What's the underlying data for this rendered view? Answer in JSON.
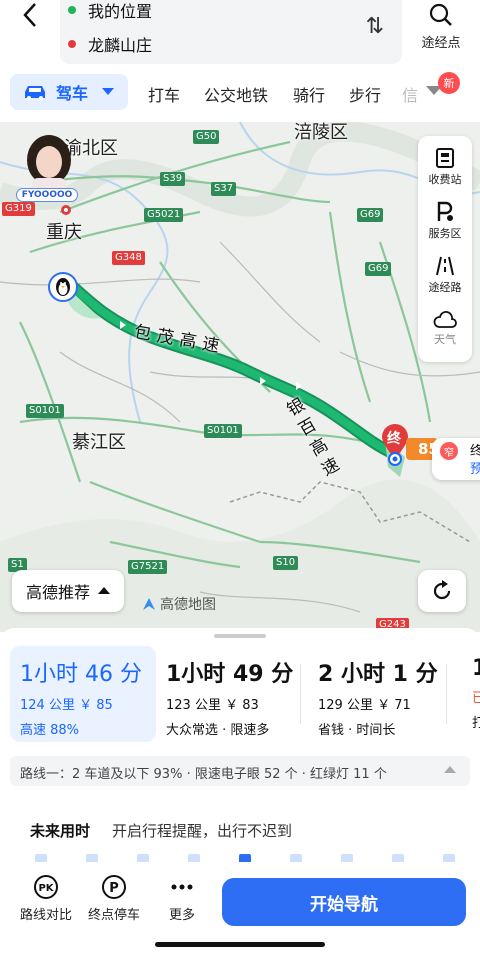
{
  "header": {
    "origin": "我的位置",
    "destination": "龙麟山庄",
    "waypoint_label": "途经点",
    "origin_color": "#1fb455",
    "destination_color": "#e23b3b"
  },
  "modes": {
    "drive_label": "驾车",
    "items": [
      "打车",
      "公交地铁",
      "骑行",
      "步行"
    ],
    "new_badge": "新"
  },
  "map": {
    "places": [
      "渝北区",
      "涪陵区",
      "重庆",
      "綦江区"
    ],
    "road_badges": [
      "G50",
      "S39",
      "S37",
      "G5021",
      "G69",
      "G348",
      "G69",
      "S0101",
      "S0101",
      "G7521",
      "S10",
      "G243",
      "G319"
    ],
    "route_label_1": "包茂高速",
    "route_label_2": "银百高速",
    "avatar_tag": "FYOOOOO",
    "end_marker": "终",
    "end_marker_extra": "85",
    "popup_text_1": "终",
    "popup_text_2": "预",
    "popup_badge": "窄",
    "tools": [
      {
        "label": "收费站",
        "icon": "toll-booth-icon"
      },
      {
        "label": "服务区",
        "icon": "service-area-icon"
      },
      {
        "label": "途经路",
        "icon": "road-icon"
      },
      {
        "label": "天气",
        "icon": "cloud-icon"
      }
    ],
    "recommend_label": "高德推荐",
    "logo_text": "高德地图",
    "route_color": "#1aa260"
  },
  "routes": [
    {
      "time": "1小时 46 分",
      "meta": "124 公里 ￥ 85",
      "tag": "高速 88%"
    },
    {
      "time": "1小时 49 分",
      "meta": "123 公里 ￥ 83",
      "tag": "大众常选 · 限速多"
    },
    {
      "time": "2 小时 1 分",
      "meta": "129 公里 ￥ 71",
      "tag": "省钱 · 时间长"
    },
    {
      "time": "1",
      "meta": "已",
      "tag": "打"
    }
  ],
  "route_detail": "路线一：2 车道及以下 93% · 限速电子眼 52 个 · 红绿灯 11 个",
  "future": {
    "title": "未来用时",
    "desc": "开启行程提醒，出行不迟到"
  },
  "bottom": {
    "compare": "路线对比",
    "parking": "终点停车",
    "more": "更多",
    "start": "开始导航"
  }
}
